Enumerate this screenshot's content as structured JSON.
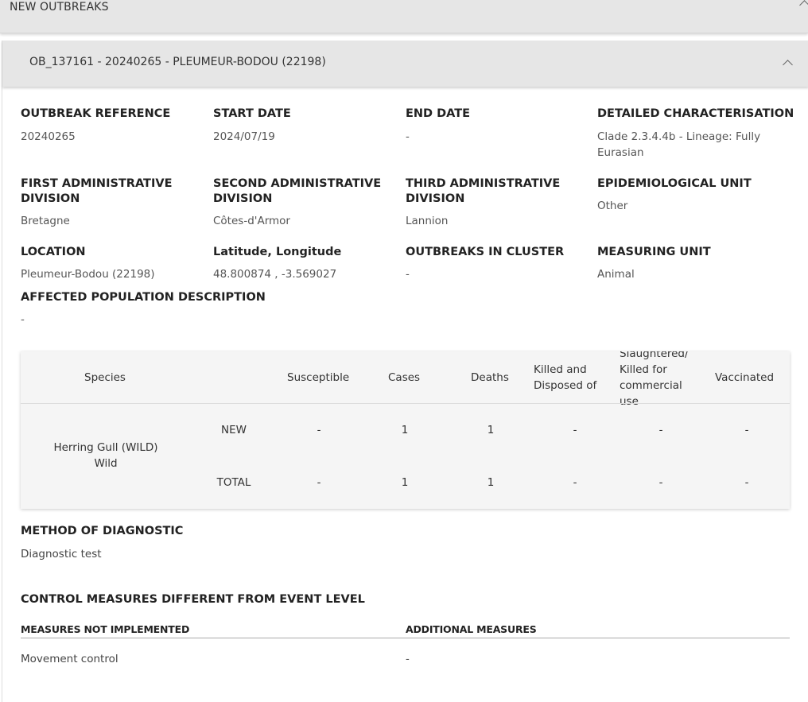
{
  "top": {
    "title": "NEW OUTBREAKS"
  },
  "outbreak": {
    "header": "OB_137161 - 20240265 - PLEUMEUR-BODOU (22198)",
    "fields": {
      "ref_label": "OUTBREAK REFERENCE",
      "ref_value": "20240265",
      "start_label": "START DATE",
      "start_value": "2024/07/19",
      "end_label": "END DATE",
      "end_value": "-",
      "char_label": "DETAILED CHARACTERISATION",
      "char_value_1": "Clade 2.3.4.4b - Lineage: Fully",
      "char_value_2": "Eurasian",
      "adm1_label_1": "FIRST ADMINISTRATIVE",
      "adm1_label_2": "DIVISION",
      "adm1_value": "Bretagne",
      "adm2_label_1": "SECOND ADMINISTRATIVE",
      "adm2_label_2": "DIVISION",
      "adm2_value": "Côtes-d'Armor",
      "adm3_label_1": "THIRD ADMINISTRATIVE",
      "adm3_label_2": "DIVISION",
      "adm3_value": "Lannion",
      "epi_label": "EPIDEMIOLOGICAL UNIT",
      "epi_value": "Other",
      "loc_label": "LOCATION",
      "loc_value": "Pleumeur-Bodou (22198)",
      "latlon_label": "Latitude, Longitude",
      "latlon_value": "48.800874 , -3.569027",
      "cluster_label": "OUTBREAKS IN CLUSTER",
      "cluster_value": "-",
      "unit_label": "MEASURING UNIT",
      "unit_value": "Animal",
      "pop_label": "AFFECTED POPULATION DESCRIPTION",
      "pop_value": "-"
    },
    "table": {
      "headers": {
        "species": "Species",
        "susceptible": "Susceptible",
        "cases": "Cases",
        "deaths": "Deaths",
        "killed_1": "Killed and",
        "killed_2": "Disposed of",
        "slaughtered_1": "Slaughtered/",
        "slaughtered_2": "Killed for",
        "slaughtered_3": "commercial",
        "slaughtered_4": "use",
        "vaccinated": "Vaccinated"
      },
      "species_name": "Herring Gull (WILD)",
      "species_type": "Wild",
      "rows": [
        {
          "label": "NEW",
          "susceptible": "-",
          "cases": "1",
          "deaths": "1",
          "killed": "-",
          "slaughtered": "-",
          "vaccinated": "-"
        },
        {
          "label": "TOTAL",
          "susceptible": "-",
          "cases": "1",
          "deaths": "1",
          "killed": "-",
          "slaughtered": "-",
          "vaccinated": "-"
        }
      ]
    },
    "diagnostic": {
      "label": "METHOD OF DIAGNOSTIC",
      "value": "Diagnostic test"
    },
    "control": {
      "title": "CONTROL MEASURES DIFFERENT FROM EVENT LEVEL",
      "not_implemented_label": "MEASURES NOT IMPLEMENTED",
      "additional_label": "ADDITIONAL MEASURES",
      "not_implemented_value": "Movement control",
      "additional_value": "-"
    }
  }
}
